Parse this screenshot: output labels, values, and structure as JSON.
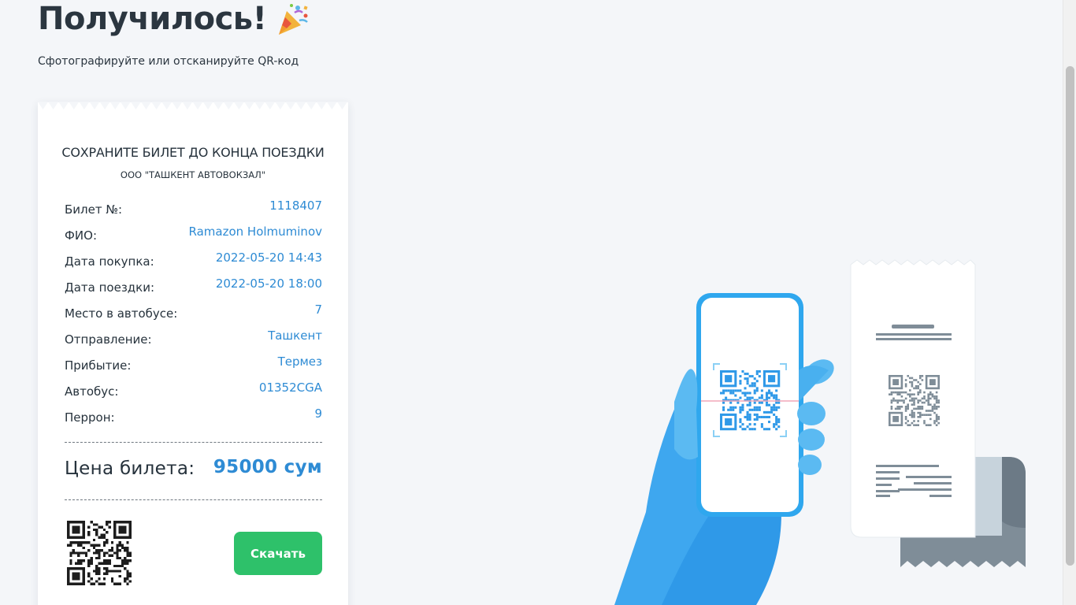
{
  "header": {
    "title": "Получилось!",
    "subtitle": "Сфотографируйте или отсканируйте QR-код"
  },
  "ticket": {
    "heading": "СОХРАНИТЕ БИЛЕТ ДО КОНЦА ПОЕЗДКИ",
    "company": "ООО \"ТАШКЕНТ АВТОВОКЗАЛ\"",
    "rows": [
      {
        "label": "Билет №:",
        "value": "1118407"
      },
      {
        "label": "ФИО:",
        "value": "Ramazon Holmuminov"
      },
      {
        "label": "Дата покупка:",
        "value": "2022-05-20 14:43"
      },
      {
        "label": "Дата поездки:",
        "value": "2022-05-20 18:00"
      },
      {
        "label": "Место в автобусе:",
        "value": "7"
      },
      {
        "label": "Отправление:",
        "value": "Ташкент"
      },
      {
        "label": "Прибытие:",
        "value": "Термез"
      },
      {
        "label": "Автобус:",
        "value": "01352CGA"
      },
      {
        "label": "Перрон:",
        "value": "9"
      }
    ],
    "price_label": "Цена билета:",
    "price_value": "95000 сум",
    "download_label": "Скачать"
  },
  "icons": {
    "title_icon": "party-popper-icon",
    "ticket_qr": "qr-code-icon",
    "illustration": "phone-scanning-qr-illustration"
  },
  "colors": {
    "accent_blue": "#2e8bd4",
    "button_green": "#2ec16a",
    "text_dark": "#26323c",
    "background": "#f4f6f9"
  }
}
